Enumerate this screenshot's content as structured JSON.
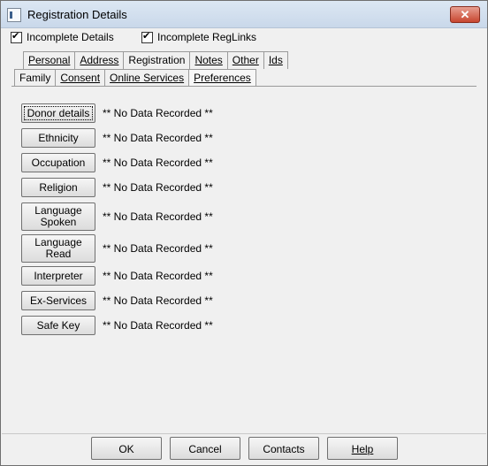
{
  "window": {
    "title": "Registration Details",
    "close_glyph": "✕"
  },
  "checks": {
    "incomplete_details": "Incomplete Details",
    "incomplete_reglinks": "Incomplete RegLinks"
  },
  "tabs_row1": [
    "Personal",
    "Address",
    "Registration",
    "Notes",
    "Other",
    "Ids"
  ],
  "tabs_row2": [
    "Family",
    "Consent",
    "Online Services",
    "Preferences"
  ],
  "active_tab": "Preferences",
  "fields": [
    {
      "label": "Donor details",
      "value": "** No Data Recorded **"
    },
    {
      "label": "Ethnicity",
      "value": "** No Data Recorded **"
    },
    {
      "label": "Occupation",
      "value": "** No Data Recorded **"
    },
    {
      "label": "Religion",
      "value": "** No Data Recorded **"
    },
    {
      "label": "Language Spoken",
      "value": "** No Data Recorded **"
    },
    {
      "label": "Language Read",
      "value": "** No Data Recorded **"
    },
    {
      "label": "Interpreter",
      "value": "** No Data Recorded **"
    },
    {
      "label": "Ex-Services",
      "value": "** No Data Recorded **"
    },
    {
      "label": "Safe Key",
      "value": "** No Data Recorded **"
    }
  ],
  "buttons": {
    "ok": "OK",
    "cancel": "Cancel",
    "contacts": "Contacts",
    "help": "Help"
  },
  "colors": {
    "titlebar": "#c9d8ea",
    "close": "#c7462f",
    "dialog_bg": "#f0f0f0"
  }
}
